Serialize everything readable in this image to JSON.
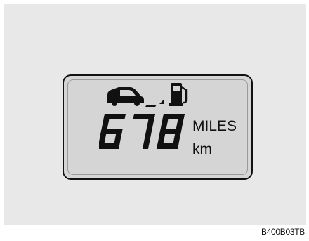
{
  "display": {
    "range_value": "678",
    "unit_primary": "MILES",
    "unit_secondary": "km",
    "icons": [
      "car-icon",
      "range-arrow-icon",
      "fuel-pump-icon"
    ]
  },
  "figure_code": "B400B03TB",
  "colors": {
    "background": "#e8e8e8",
    "lcd": "#d5d5d5",
    "segment": "#111111"
  }
}
